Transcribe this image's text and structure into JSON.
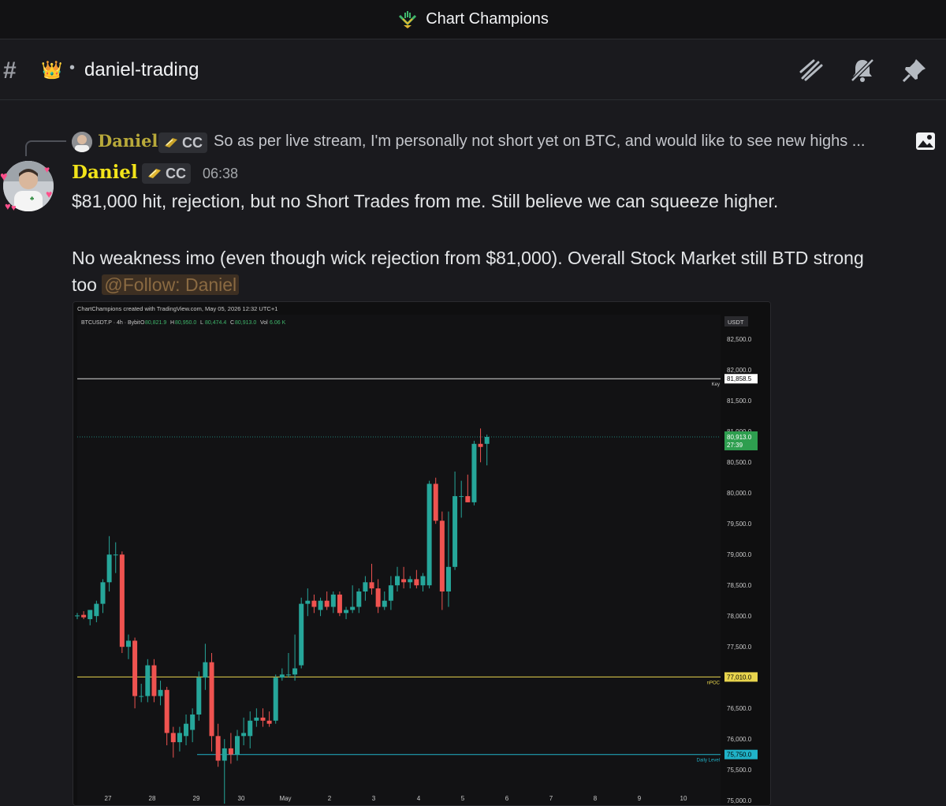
{
  "server": {
    "name": "Chart Champions"
  },
  "channel": {
    "name": "daniel-trading",
    "dot": "•"
  },
  "header_icons": [
    "threads-icon",
    "notifications-muted-icon",
    "pin-icon"
  ],
  "reply": {
    "author": "Daniel",
    "tag": "CC",
    "text": "So as per live stream, I'm personally not short yet on BTC, and would like to see new highs ..."
  },
  "message": {
    "author": "Daniel",
    "tag": "CC",
    "time": "06:38",
    "line1": "$81,000 hit, rejection, but no Short Trades from me. Still believe we can squeeze higher.",
    "line2": "No weakness imo (even though wick rejection from $81,000). Overall Stock Market still BTD strong",
    "line3_prefix": "too",
    "mention": "@Follow: Daniel"
  },
  "chart_header": {
    "credit": "ChartChampions created with TradingView.com, May 05, 2026 12:32 UTC+1",
    "symbol": "BTCUSDT.P · 4h · Bybit",
    "o_label": "O",
    "o": "80,821.9",
    "h_label": "H",
    "h": "80,950.0",
    "l_label": "L",
    "l": "80,474.4",
    "c_label": "C",
    "c": "80,913.0",
    "vol_label": "Vol",
    "vol": "6.06 K"
  },
  "chart_data": {
    "type": "candlestick",
    "currency": "USDT",
    "ylim": [
      74900,
      82900
    ],
    "y_ticks": [
      "82,500.0",
      "82,000.0",
      "81,500.0",
      "81,000.0",
      "80,500.0",
      "80,000.0",
      "79,500.0",
      "79,000.0",
      "78,500.0",
      "78,000.0",
      "77,500.0",
      "77,000.0",
      "76,500.0",
      "76,000.0",
      "75,500.0",
      "75,000.0"
    ],
    "y_tick_values": [
      82500,
      82000,
      81500,
      81000,
      80500,
      80000,
      79500,
      79000,
      78500,
      78000,
      77500,
      77000,
      76500,
      76000,
      75500,
      75000
    ],
    "x_labels": [
      "27",
      "28",
      "29",
      "30",
      "May",
      "2",
      "3",
      "4",
      "5",
      "6",
      "7",
      "8",
      "9",
      "10"
    ],
    "levels": [
      {
        "name": "Key",
        "value": 81858.5,
        "label": "81,858.5",
        "color": "#d9d9d9"
      },
      {
        "name": "nPOC",
        "value": 77010.0,
        "label": "77,010.0",
        "color": "#e8d44d"
      },
      {
        "name": "Daily Level",
        "value": 75750.0,
        "label": "75,750.0",
        "color": "#20b2c8"
      }
    ],
    "last_price": {
      "value": 80913.0,
      "label": "80,913.0",
      "countdown": "27:39"
    },
    "candles": [
      {
        "o": 78000,
        "h": 78050,
        "l": 77950,
        "c": 78010
      },
      {
        "o": 78020,
        "h": 78080,
        "l": 77950,
        "c": 77980
      },
      {
        "o": 77950,
        "h": 78100,
        "l": 77850,
        "c": 78100
      },
      {
        "o": 78000,
        "h": 78250,
        "l": 77900,
        "c": 78200
      },
      {
        "o": 78200,
        "h": 78600,
        "l": 78050,
        "c": 78550
      },
      {
        "o": 78550,
        "h": 79300,
        "l": 78400,
        "c": 79000
      },
      {
        "o": 79000,
        "h": 79200,
        "l": 78700,
        "c": 79000
      },
      {
        "o": 79000,
        "h": 79050,
        "l": 77400,
        "c": 77500
      },
      {
        "o": 77500,
        "h": 77700,
        "l": 77300,
        "c": 77600
      },
      {
        "o": 77600,
        "h": 77650,
        "l": 76500,
        "c": 76700
      },
      {
        "o": 76700,
        "h": 76900,
        "l": 76600,
        "c": 76700
      },
      {
        "o": 76700,
        "h": 77300,
        "l": 76600,
        "c": 77200
      },
      {
        "o": 77200,
        "h": 77300,
        "l": 76600,
        "c": 76700
      },
      {
        "o": 76700,
        "h": 76950,
        "l": 76550,
        "c": 76800
      },
      {
        "o": 76800,
        "h": 76850,
        "l": 75900,
        "c": 76100
      },
      {
        "o": 76100,
        "h": 76200,
        "l": 75700,
        "c": 75950
      },
      {
        "o": 75950,
        "h": 76200,
        "l": 75800,
        "c": 76100
      },
      {
        "o": 76050,
        "h": 76400,
        "l": 75900,
        "c": 76250
      },
      {
        "o": 76150,
        "h": 76500,
        "l": 75950,
        "c": 76400
      },
      {
        "o": 76400,
        "h": 77100,
        "l": 76300,
        "c": 77000
      },
      {
        "o": 77000,
        "h": 77550,
        "l": 76800,
        "c": 77250
      },
      {
        "o": 77250,
        "h": 77400,
        "l": 75800,
        "c": 76050
      },
      {
        "o": 76050,
        "h": 76250,
        "l": 75550,
        "c": 75650
      },
      {
        "o": 75650,
        "h": 76000,
        "l": 74950,
        "c": 75850
      },
      {
        "o": 75850,
        "h": 76100,
        "l": 75600,
        "c": 75750
      },
      {
        "o": 75750,
        "h": 76150,
        "l": 75650,
        "c": 76050
      },
      {
        "o": 76050,
        "h": 76350,
        "l": 75900,
        "c": 76100
      },
      {
        "o": 76050,
        "h": 76450,
        "l": 75850,
        "c": 76300
      },
      {
        "o": 76300,
        "h": 76500,
        "l": 76200,
        "c": 76350
      },
      {
        "o": 76350,
        "h": 76500,
        "l": 76200,
        "c": 76300
      },
      {
        "o": 76300,
        "h": 76450,
        "l": 76200,
        "c": 76250
      },
      {
        "o": 76300,
        "h": 77050,
        "l": 76250,
        "c": 77000
      },
      {
        "o": 77000,
        "h": 77150,
        "l": 76950,
        "c": 77050
      },
      {
        "o": 77050,
        "h": 77400,
        "l": 77000,
        "c": 77050
      },
      {
        "o": 77050,
        "h": 77700,
        "l": 76950,
        "c": 77150
      },
      {
        "o": 77200,
        "h": 78300,
        "l": 77150,
        "c": 78200
      },
      {
        "o": 78200,
        "h": 78450,
        "l": 78000,
        "c": 78250
      },
      {
        "o": 78250,
        "h": 78350,
        "l": 78050,
        "c": 78150
      },
      {
        "o": 78100,
        "h": 78300,
        "l": 78000,
        "c": 78250
      },
      {
        "o": 78250,
        "h": 78400,
        "l": 78100,
        "c": 78150
      },
      {
        "o": 78150,
        "h": 78400,
        "l": 78050,
        "c": 78350
      },
      {
        "o": 78350,
        "h": 78400,
        "l": 78000,
        "c": 78050
      },
      {
        "o": 78050,
        "h": 78150,
        "l": 77950,
        "c": 78100
      },
      {
        "o": 78100,
        "h": 78500,
        "l": 78050,
        "c": 78150
      },
      {
        "o": 78150,
        "h": 78450,
        "l": 78050,
        "c": 78400
      },
      {
        "o": 78400,
        "h": 78650,
        "l": 78250,
        "c": 78550
      },
      {
        "o": 78550,
        "h": 78850,
        "l": 78350,
        "c": 78450
      },
      {
        "o": 78450,
        "h": 78600,
        "l": 78050,
        "c": 78150
      },
      {
        "o": 78150,
        "h": 78400,
        "l": 78100,
        "c": 78250
      },
      {
        "o": 78250,
        "h": 78650,
        "l": 78100,
        "c": 78500
      },
      {
        "o": 78500,
        "h": 78800,
        "l": 78400,
        "c": 78650
      },
      {
        "o": 78600,
        "h": 78800,
        "l": 78450,
        "c": 78550
      },
      {
        "o": 78550,
        "h": 78650,
        "l": 78450,
        "c": 78600
      },
      {
        "o": 78600,
        "h": 78750,
        "l": 78450,
        "c": 78500
      },
      {
        "o": 78500,
        "h": 78700,
        "l": 78400,
        "c": 78650
      },
      {
        "o": 78500,
        "h": 80200,
        "l": 78450,
        "c": 80150
      },
      {
        "o": 80150,
        "h": 80250,
        "l": 79500,
        "c": 79550
      },
      {
        "o": 79550,
        "h": 79700,
        "l": 78100,
        "c": 78400
      },
      {
        "o": 78400,
        "h": 79700,
        "l": 78150,
        "c": 78800
      },
      {
        "o": 78800,
        "h": 80350,
        "l": 78750,
        "c": 79950
      },
      {
        "o": 79950,
        "h": 80200,
        "l": 79600,
        "c": 79950
      },
      {
        "o": 79950,
        "h": 80300,
        "l": 79850,
        "c": 79850
      },
      {
        "o": 79850,
        "h": 80850,
        "l": 79800,
        "c": 80800
      },
      {
        "o": 80800,
        "h": 81050,
        "l": 80500,
        "c": 80750
      },
      {
        "o": 80800,
        "h": 80950,
        "l": 80450,
        "c": 80913
      }
    ]
  },
  "colors": {
    "up": "#26a69a",
    "down": "#ef5350",
    "accent_name": "#f2e41a"
  }
}
